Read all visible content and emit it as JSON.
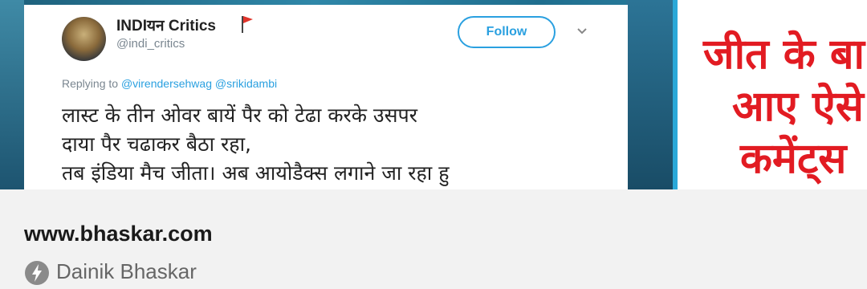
{
  "tweet": {
    "display_name": "INDIयन Critics",
    "handle": "@indi_critics",
    "follow_label": "Follow",
    "replying_prefix": "Replying to",
    "replying_users": "@virendersehwag @srikidambi",
    "text": "लास्ट के तीन ओवर बायें पैर को टेढा करके उसपर\nदाया पैर चढाकर बैठा रहा,\nतब इंडिया मैच जीता। अब आयोडैक्स लगाने जा रहा हु"
  },
  "headline": {
    "line1": "जीत के बा",
    "line2": "आए ऐसे",
    "line3": "कमेंट्स"
  },
  "footer": {
    "site": "www.bhaskar.com",
    "source": "Dainik Bhaskar"
  },
  "colors": {
    "accent": "#2aa0e0",
    "headline_red": "#e21b22"
  }
}
